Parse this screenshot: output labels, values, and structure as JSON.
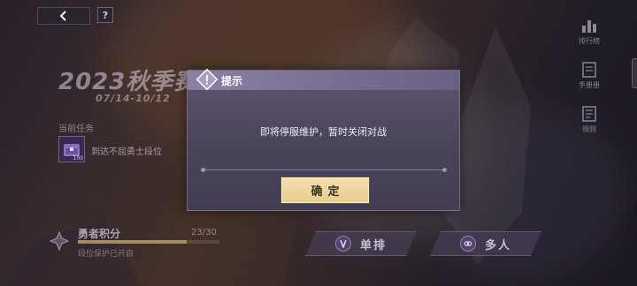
{
  "top_bar": {
    "help_label": "?"
  },
  "season": {
    "title": "2023秋季赛",
    "date_range": "07/14-10/12"
  },
  "task": {
    "section_label": "当前任务",
    "reward_badge": "100",
    "description": "到达不屈勇士段位"
  },
  "score": {
    "label": "勇者积分",
    "count": "23/30",
    "progress": 0.77,
    "note": "段位保护已开启"
  },
  "modes": {
    "solo_label": "单排",
    "multi_label": "多人"
  },
  "side_menu": {
    "rank_label": "排行榜",
    "notes_label": "手册册",
    "rules_label": "规则"
  },
  "dialog": {
    "title": "提示",
    "message": "即将停服维护，暂时关闭对战",
    "confirm_label": "确定"
  },
  "colors": {
    "dialog_header": "#8b80a3",
    "dialog_body": "#4a445a",
    "confirm_button": "#f4dfae"
  }
}
